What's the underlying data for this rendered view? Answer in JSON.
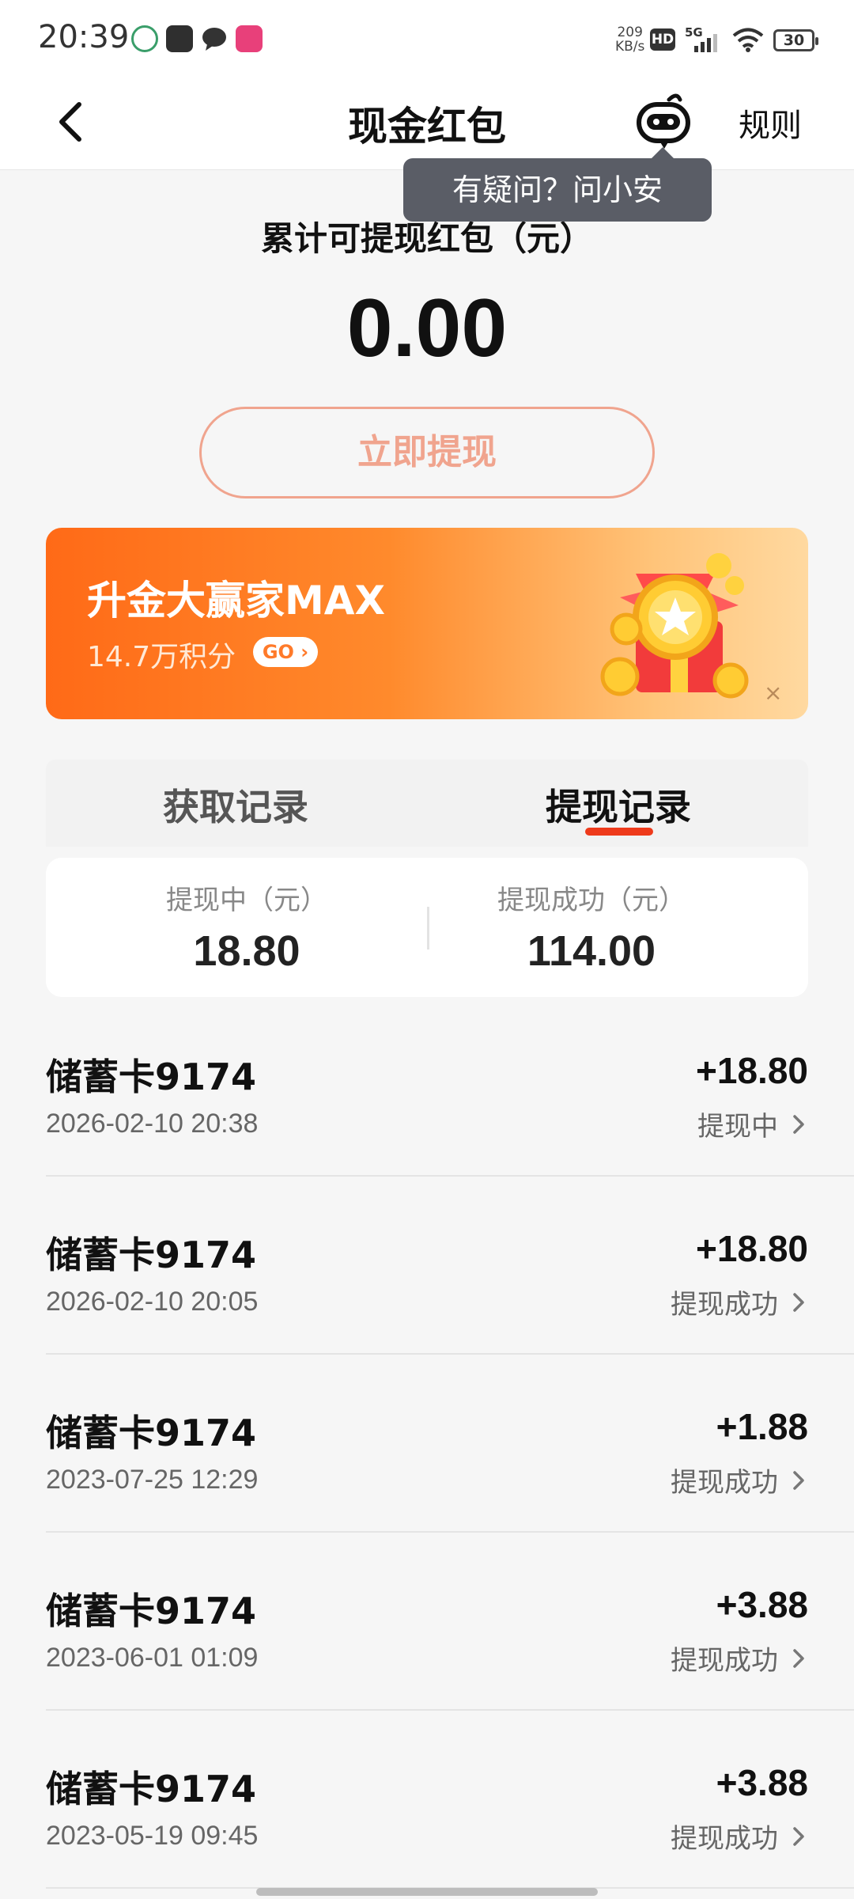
{
  "status_bar": {
    "time": "20:39",
    "net_speed_value": "209",
    "net_speed_unit": "KB/s",
    "hd": "HD",
    "network": "5G",
    "battery": "30"
  },
  "header": {
    "title": "现金红包",
    "rules": "规则",
    "back_icon": "chevron-left-icon",
    "bot_icon": "assistant-bot-icon"
  },
  "tooltip": {
    "text": "有疑问？问小安"
  },
  "balance": {
    "label": "累计可提现红包（元）",
    "amount": "0.00",
    "button": "立即提现"
  },
  "banner": {
    "title": "升金大赢家MAX",
    "points": "14.7万积分",
    "go": "GO",
    "close": "×"
  },
  "tabs": [
    {
      "label": "获取记录",
      "active": false
    },
    {
      "label": "提现记录",
      "active": true
    }
  ],
  "summary": {
    "pending_label": "提现中（元）",
    "pending_value": "18.80",
    "success_label": "提现成功（元）",
    "success_value": "114.00"
  },
  "records": [
    {
      "card": "储蓄卡9174",
      "date": "2026-02-10 20:38",
      "amount": "+18.80",
      "status": "提现中"
    },
    {
      "card": "储蓄卡9174",
      "date": "2026-02-10 20:05",
      "amount": "+18.80",
      "status": "提现成功"
    },
    {
      "card": "储蓄卡9174",
      "date": "2023-07-25 12:29",
      "amount": "+1.88",
      "status": "提现成功"
    },
    {
      "card": "储蓄卡9174",
      "date": "2023-06-01 01:09",
      "amount": "+3.88",
      "status": "提现成功"
    },
    {
      "card": "储蓄卡9174",
      "date": "2023-05-19 09:45",
      "amount": "+3.88",
      "status": "提现成功"
    }
  ],
  "colors": {
    "accent_red": "#ee3a1b",
    "button_outline": "#f0a48e",
    "banner_start": "#ff6a17",
    "banner_end": "#ffd9a0"
  }
}
